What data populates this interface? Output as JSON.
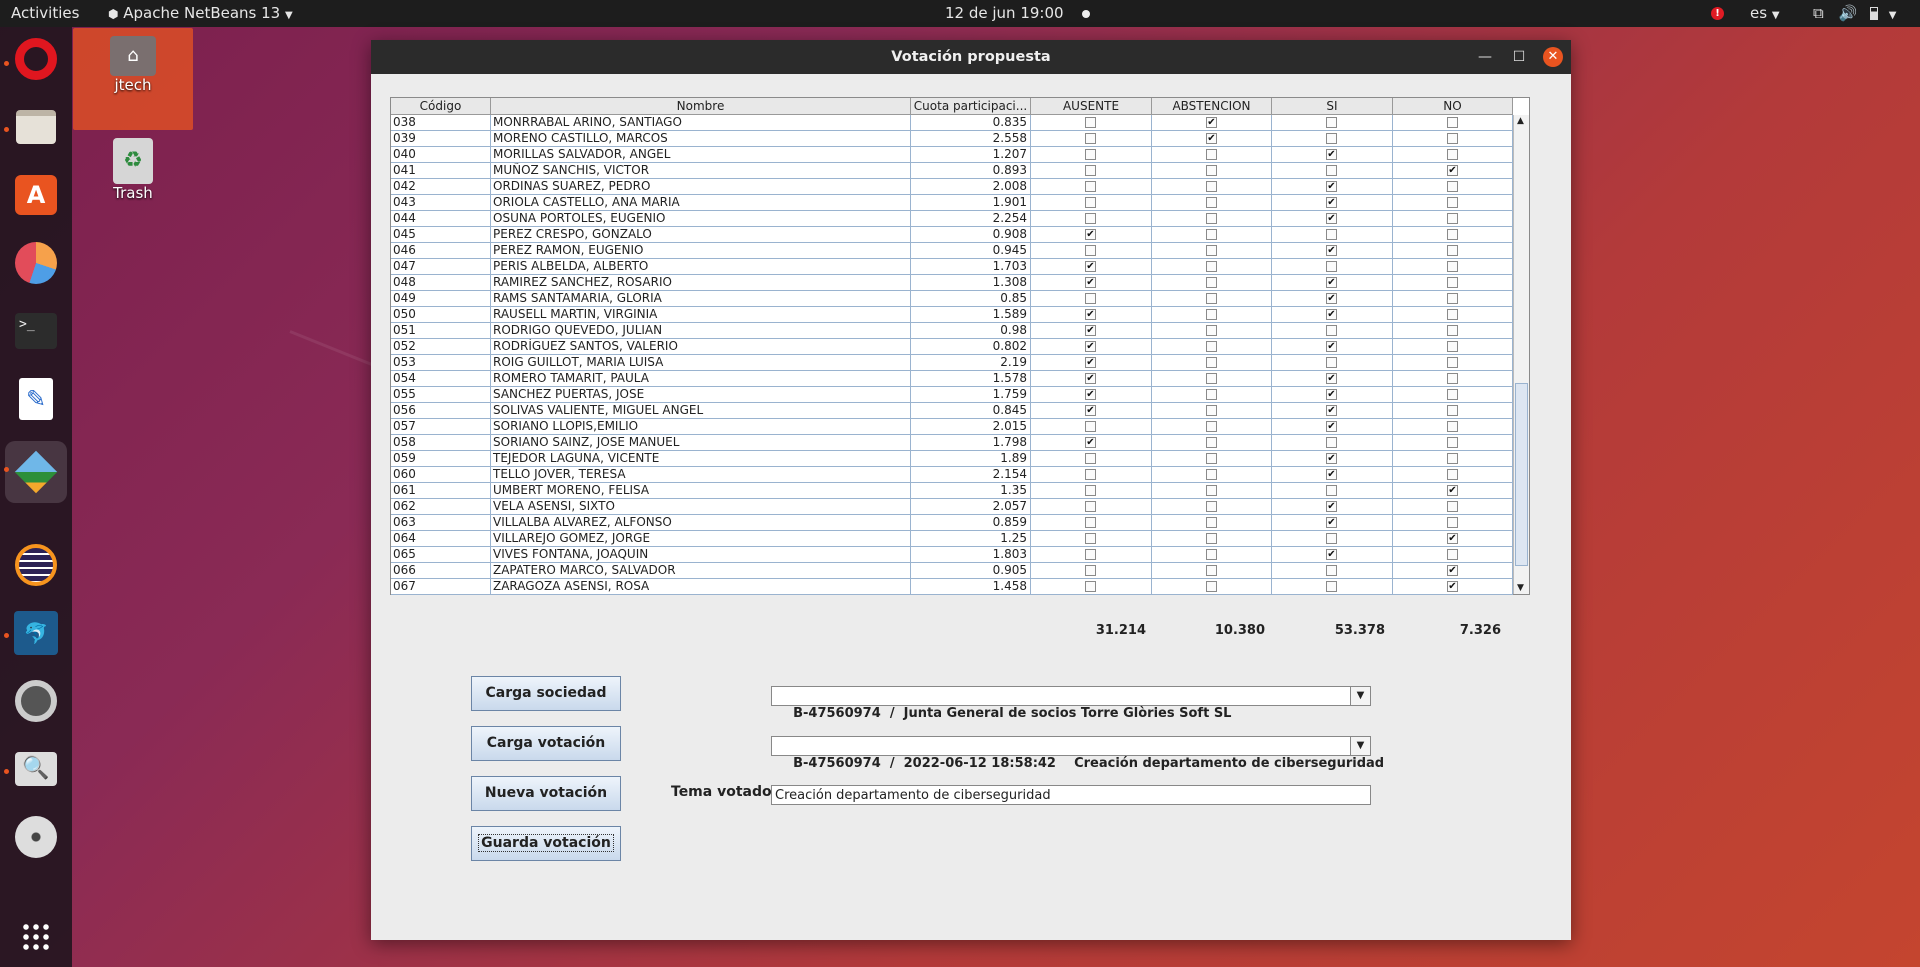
{
  "topbar": {
    "activities": "Activities",
    "app_menu": "Apache NetBeans 13",
    "clock": "12 de jun  19:00",
    "lang": "es"
  },
  "desktop": {
    "home_label": "jtech",
    "trash_label": "Trash"
  },
  "window": {
    "title": "Votación propuesta"
  },
  "table": {
    "columns": [
      "Código",
      "Nombre",
      "Cuota participaci...",
      "AUSENTE",
      "ABSTENCION",
      "SI",
      "NO"
    ],
    "rows": [
      {
        "code": "038",
        "name": "MONRRABAL ARINO, SANTIAGO",
        "cuota": "0.835",
        "aus": false,
        "abs": true,
        "si": false,
        "no": false
      },
      {
        "code": "039",
        "name": "MORENO CASTILLO, MARCOS",
        "cuota": "2.558",
        "aus": false,
        "abs": true,
        "si": false,
        "no": false
      },
      {
        "code": "040",
        "name": "MORILLAS SALVADOR, ANGEL",
        "cuota": "1.207",
        "aus": false,
        "abs": false,
        "si": true,
        "no": false
      },
      {
        "code": "041",
        "name": "MUÑOZ SANCHIS, VICTOR",
        "cuota": "0.893",
        "aus": false,
        "abs": false,
        "si": false,
        "no": true
      },
      {
        "code": "042",
        "name": "ORDINAS SUAREZ, PEDRO",
        "cuota": "2.008",
        "aus": false,
        "abs": false,
        "si": true,
        "no": false
      },
      {
        "code": "043",
        "name": "ORIOLA CASTELLO, ANA MARIA",
        "cuota": "1.901",
        "aus": false,
        "abs": false,
        "si": true,
        "no": false
      },
      {
        "code": "044",
        "name": "OSUNA PORTOLES, EUGENIO",
        "cuota": "2.254",
        "aus": false,
        "abs": false,
        "si": true,
        "no": false
      },
      {
        "code": "045",
        "name": "PEREZ CRESPO, GONZALO",
        "cuota": "0.908",
        "aus": true,
        "abs": false,
        "si": false,
        "no": false
      },
      {
        "code": "046",
        "name": "PEREZ RAMON, EUGENIO",
        "cuota": "0.945",
        "aus": false,
        "abs": false,
        "si": true,
        "no": false
      },
      {
        "code": "047",
        "name": "PERIS ALBELDA, ALBERTO",
        "cuota": "1.703",
        "aus": true,
        "abs": false,
        "si": false,
        "no": false
      },
      {
        "code": "048",
        "name": "RAMIREZ SANCHEZ, ROSARIO",
        "cuota": "1.308",
        "aus": true,
        "abs": false,
        "si": true,
        "no": false
      },
      {
        "code": "049",
        "name": "RAMS SANTAMARIA, GLORIA",
        "cuota": "0.85",
        "aus": false,
        "abs": false,
        "si": true,
        "no": false
      },
      {
        "code": "050",
        "name": "RAUSELL MARTIN, VIRGINIA",
        "cuota": "1.589",
        "aus": true,
        "abs": false,
        "si": true,
        "no": false
      },
      {
        "code": "051",
        "name": "RODRIGO QUEVEDO, JULIAN",
        "cuota": "0.98",
        "aus": true,
        "abs": false,
        "si": false,
        "no": false
      },
      {
        "code": "052",
        "name": "RODRÍGUEZ SANTOS, VALERIO",
        "cuota": "0.802",
        "aus": true,
        "abs": false,
        "si": true,
        "no": false
      },
      {
        "code": "053",
        "name": "ROIG GUILLOT, MARIA LUISA",
        "cuota": "2.19",
        "aus": true,
        "abs": false,
        "si": false,
        "no": false
      },
      {
        "code": "054",
        "name": "ROMERO TAMARIT, PAULA",
        "cuota": "1.578",
        "aus": true,
        "abs": false,
        "si": true,
        "no": false
      },
      {
        "code": "055",
        "name": "SANCHEZ PUERTAS, JOSE",
        "cuota": "1.759",
        "aus": true,
        "abs": false,
        "si": true,
        "no": false
      },
      {
        "code": "056",
        "name": "SOLIVAS VALIENTE, MIGUEL ANGEL",
        "cuota": "0.845",
        "aus": true,
        "abs": false,
        "si": true,
        "no": false
      },
      {
        "code": "057",
        "name": "SORIANO LLOPIS,EMILIO",
        "cuota": "2.015",
        "aus": false,
        "abs": false,
        "si": true,
        "no": false
      },
      {
        "code": "058",
        "name": "SORIANO SAINZ, JOSE MANUEL",
        "cuota": "1.798",
        "aus": true,
        "abs": false,
        "si": false,
        "no": false
      },
      {
        "code": "059",
        "name": "TEJEDOR LAGUNA, VICENTE",
        "cuota": "1.89",
        "aus": false,
        "abs": false,
        "si": true,
        "no": false
      },
      {
        "code": "060",
        "name": "TELLO JOVER, TERESA",
        "cuota": "2.154",
        "aus": false,
        "abs": false,
        "si": true,
        "no": false
      },
      {
        "code": "061",
        "name": "UMBERT MORENO, FELISA",
        "cuota": "1.35",
        "aus": false,
        "abs": false,
        "si": false,
        "no": true
      },
      {
        "code": "062",
        "name": "VELA ASENSI, SIXTO",
        "cuota": "2.057",
        "aus": false,
        "abs": false,
        "si": true,
        "no": false
      },
      {
        "code": "063",
        "name": "VILLALBA ALVAREZ, ALFONSO",
        "cuota": "0.859",
        "aus": false,
        "abs": false,
        "si": true,
        "no": false
      },
      {
        "code": "064",
        "name": "VILLAREJO GOMEZ, JORGE",
        "cuota": "1.25",
        "aus": false,
        "abs": false,
        "si": false,
        "no": true
      },
      {
        "code": "065",
        "name": "VIVES FONTANA, JOAQUIN",
        "cuota": "1.803",
        "aus": false,
        "abs": false,
        "si": true,
        "no": false
      },
      {
        "code": "066",
        "name": "ZAPATERO MARCO, SALVADOR",
        "cuota": "0.905",
        "aus": false,
        "abs": false,
        "si": false,
        "no": true
      },
      {
        "code": "067",
        "name": "ZARAGOZA ASENSI, ROSA",
        "cuota": "1.458",
        "aus": false,
        "abs": false,
        "si": false,
        "no": true
      }
    ]
  },
  "totals": {
    "ausente": "31.214",
    "abstencion": "10.380",
    "si": "53.378",
    "no": "7.326"
  },
  "buttons": {
    "carga_sociedad": "Carga sociedad",
    "carga_votacion": "Carga votación",
    "nueva_votacion": "Nueva votación",
    "guarda_votacion": "Guarda votación"
  },
  "combos": {
    "sociedad": "B-47560974  /  Junta General de socios Torre Glòries Soft SL",
    "votacion": "B-47560974  /  2022-06-12 18:58:42    Creación departamento de ciberseguridad"
  },
  "tema": {
    "label": "Tema votado",
    "value": "Creación departamento de ciberseguridad"
  },
  "icons": {
    "check": "✔",
    "dropdown": "▼"
  }
}
